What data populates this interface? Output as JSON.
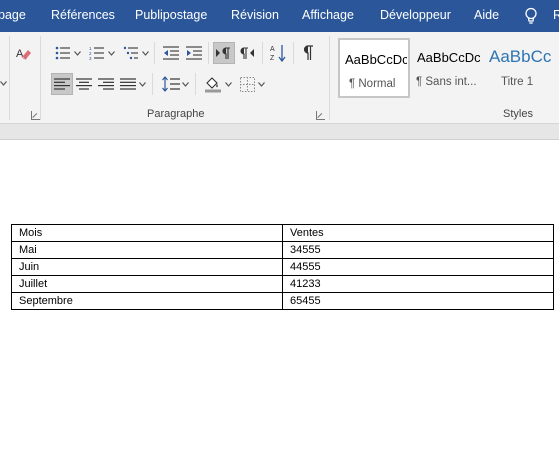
{
  "tabs": [
    "page",
    "Références",
    "Publipostage",
    "Révision",
    "Affichage",
    "Développeur",
    "Aide",
    "R"
  ],
  "ribbon": {
    "paragraph_group": {
      "label": "Paragraphe",
      "buttons": [
        "eraser-icon",
        "bullets-icon",
        "numbering-icon",
        "multilevel-list-icon",
        "decrease-indent-icon",
        "increase-indent-icon",
        "ltr-icon",
        "rtl-icon",
        "sort-icon",
        "pilcrow-icon",
        "align-left-icon",
        "center-icon",
        "align-right-icon",
        "justify-icon",
        "line-spacing-icon",
        "shading-icon",
        "borders-icon"
      ]
    },
    "styles_group": {
      "label": "Styles",
      "items": [
        {
          "sample": "AaBbCcDc",
          "name": "¶ Normal",
          "selected": true
        },
        {
          "sample": "AaBbCcDc",
          "name": "¶ Sans int...",
          "selected": false
        },
        {
          "sample": "AaBbCc",
          "name": "Titre 1",
          "selected": false,
          "color": "#2e74b5"
        }
      ]
    }
  },
  "document": {
    "table": {
      "headers": [
        "Mois",
        "Ventes"
      ],
      "rows": [
        [
          "Mai",
          "34555"
        ],
        [
          "Juin",
          "44555"
        ],
        [
          "Juillet",
          "41233"
        ],
        [
          "Septembre",
          "65455"
        ]
      ]
    }
  },
  "colors": {
    "title_bar": "#2b579a",
    "ribbon": "#f3f3f3",
    "heading_style": "#2e74b5"
  }
}
